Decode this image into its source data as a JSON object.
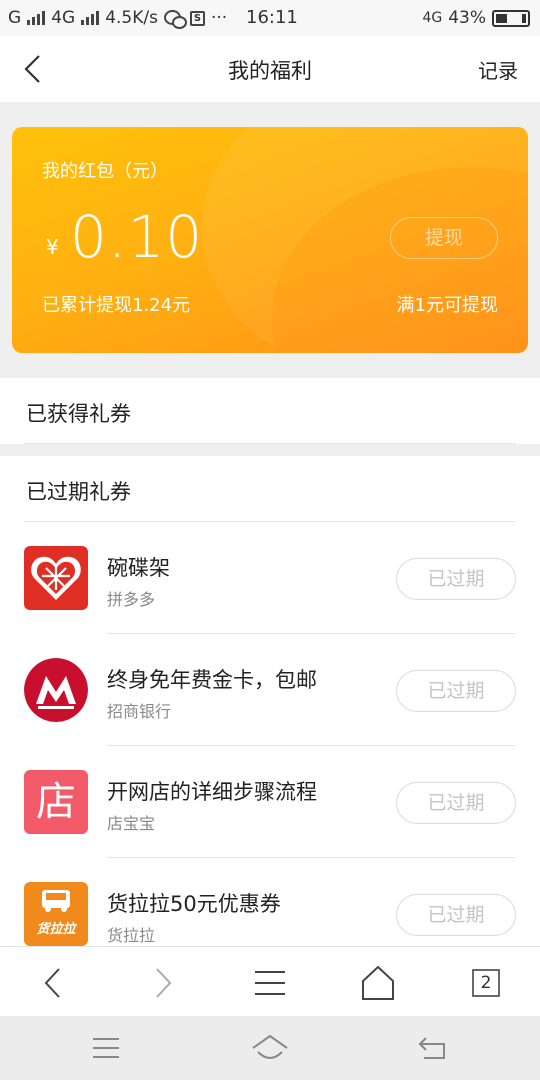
{
  "status_bar": {
    "carrier1": "G",
    "carrier2": "4G",
    "speed": "4.5K/s",
    "sim_label": "S",
    "more": "···",
    "time": "16:11",
    "network": "4G",
    "battery": "43%",
    "battery_level": 0.43
  },
  "header": {
    "title": "我的福利",
    "record_label": "记录"
  },
  "wallet": {
    "label": "我的红包（元）",
    "currency": "¥",
    "amount": "0.10",
    "withdraw_button": "提现",
    "total_withdrawn": "已累计提现1.24元",
    "minimum_note": "满1元可提现"
  },
  "obtained_section": {
    "title": "已获得礼券"
  },
  "expired_section": {
    "title": "已过期礼券",
    "items": [
      {
        "name": "碗碟架",
        "source": "拼多多",
        "status": "已过期",
        "icon": "pinduoduo-logo-icon",
        "color": "#e02e24"
      },
      {
        "name": "终身免年费金卡，包邮",
        "source": "招商银行",
        "status": "已过期",
        "icon": "cmb-logo-icon",
        "color": "#c8102e"
      },
      {
        "name": "开网店的详细步骤流程",
        "source": "店宝宝",
        "status": "已过期",
        "icon": "dianbaobao-logo-icon",
        "logo_text": "店",
        "color": "#f25a6a"
      },
      {
        "name": "货拉拉50元优惠券",
        "source": "货拉拉",
        "status": "已过期",
        "icon": "lalamove-logo-icon",
        "logo_text": "货拉拉",
        "color": "#f08a1c"
      }
    ]
  },
  "browser_bar": {
    "tab_count": "2"
  },
  "colors": {
    "card_gradient_start": "#ffc10a",
    "card_gradient_end": "#ff8f14"
  }
}
